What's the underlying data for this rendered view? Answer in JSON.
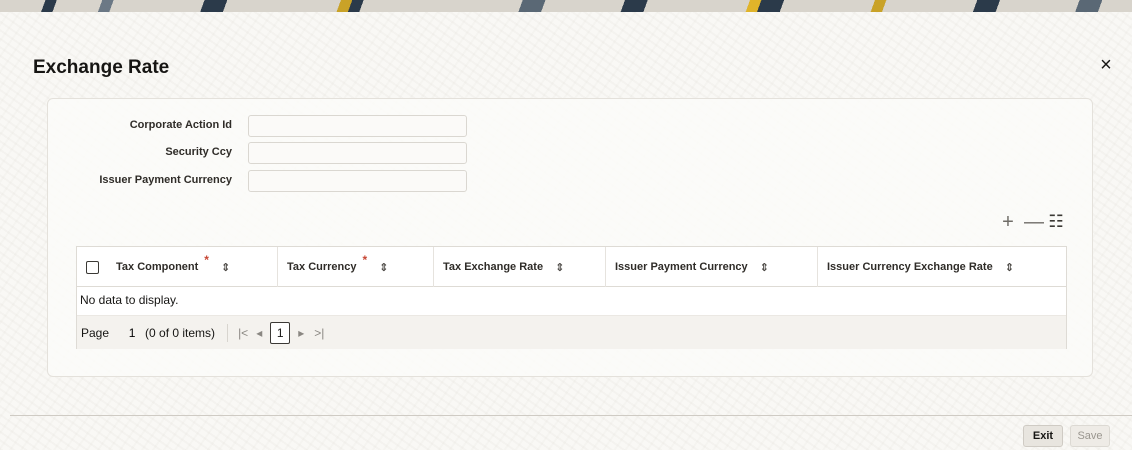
{
  "window": {
    "title": "Exchange Rate",
    "close_glyph": "×",
    "close_icon": "close-icon"
  },
  "form": {
    "fields": [
      {
        "label": "Corporate Action Id",
        "value": "",
        "placeholder": ""
      },
      {
        "label": "Security Ccy",
        "value": "",
        "placeholder": ""
      },
      {
        "label": "Issuer Payment Currency",
        "value": "",
        "placeholder": ""
      }
    ]
  },
  "toolbar": {
    "add_glyph": "+",
    "add_icon": "plus-icon",
    "remove_glyph": "—",
    "remove_icon": "minus-icon",
    "view_glyph": "☷",
    "view_icon": "list-view-icon"
  },
  "table": {
    "columns": [
      {
        "label": "Tax Component",
        "required": true,
        "required_mark": "*",
        "sort_glyph": "⇕"
      },
      {
        "label": "Tax Currency",
        "required": true,
        "required_mark": "*",
        "sort_glyph": "⇕"
      },
      {
        "label": "Tax Exchange Rate",
        "required": false,
        "sort_glyph": "⇕"
      },
      {
        "label": "Issuer Payment Currency",
        "required": false,
        "sort_glyph": "⇕"
      },
      {
        "label": "Issuer Currency Exchange Rate",
        "required": false,
        "sort_glyph": "⇕"
      }
    ],
    "empty_message": "No data to display.",
    "pagination": {
      "page_label": "Page",
      "page_value": "1",
      "count_text": "(0 of 0 items)",
      "first_glyph": "|<",
      "prev_glyph": "◂",
      "current_page": "1",
      "next_glyph": "▸",
      "last_glyph": ">|"
    }
  },
  "footer": {
    "exit_label": "Exit",
    "save_label": "Save"
  },
  "colors": {
    "required": "#c74634",
    "text": "#161513"
  }
}
